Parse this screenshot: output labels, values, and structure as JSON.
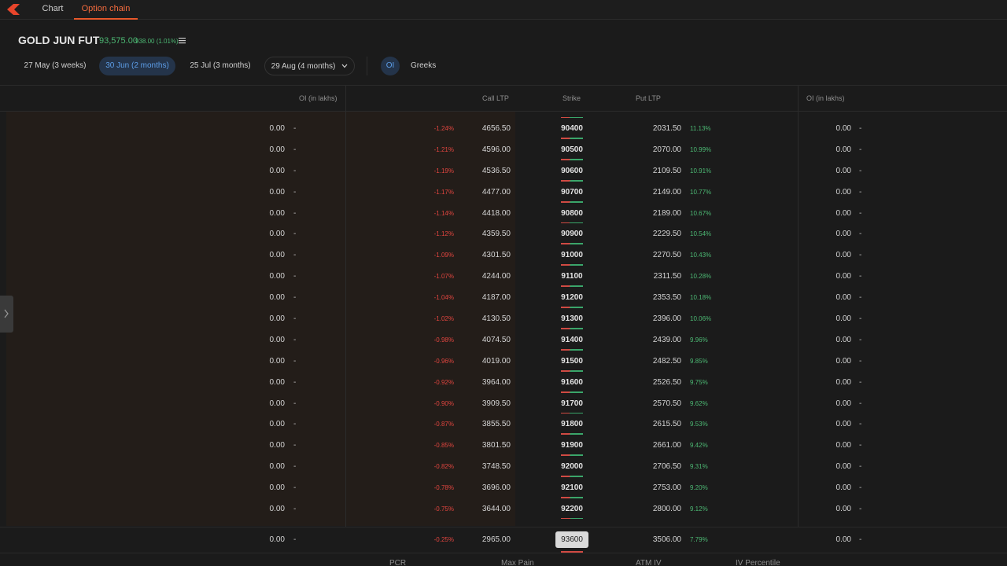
{
  "tabs": [
    {
      "label": "Chart"
    },
    {
      "label": "Option chain"
    }
  ],
  "instrument": {
    "title": "GOLD JUN FUT",
    "ltp": "93,575.00",
    "change": "938.00 (1.01%)"
  },
  "expiries": [
    {
      "label": "27 May (3 weeks)"
    },
    {
      "label": "30 Jun (2 months)"
    },
    {
      "label": "25 Jul (3 months)"
    },
    {
      "label": "29 Aug (4 months)"
    }
  ],
  "view_toggle": {
    "oi": "OI",
    "greeks": "Greeks"
  },
  "columns": {
    "call_oi": "OI (in lakhs)",
    "call_ltp": "Call LTP",
    "strike": "Strike",
    "put_ltp": "Put LTP",
    "put_oi": "OI (in lakhs)"
  },
  "rows": [
    {
      "call_oi": "0.00",
      "call_oi_chg": "-",
      "call_chg": "-1.24%",
      "call_ltp": "4656.50",
      "strike": "90400",
      "put_ltp": "2031.50",
      "put_chg": "11.13%",
      "put_oi": "0.00",
      "put_oi_chg": "-"
    },
    {
      "call_oi": "0.00",
      "call_oi_chg": "-",
      "call_chg": "-1.21%",
      "call_ltp": "4596.00",
      "strike": "90500",
      "put_ltp": "2070.00",
      "put_chg": "10.99%",
      "put_oi": "0.00",
      "put_oi_chg": "-"
    },
    {
      "call_oi": "0.00",
      "call_oi_chg": "-",
      "call_chg": "-1.19%",
      "call_ltp": "4536.50",
      "strike": "90600",
      "put_ltp": "2109.50",
      "put_chg": "10.91%",
      "put_oi": "0.00",
      "put_oi_chg": "-"
    },
    {
      "call_oi": "0.00",
      "call_oi_chg": "-",
      "call_chg": "-1.17%",
      "call_ltp": "4477.00",
      "strike": "90700",
      "put_ltp": "2149.00",
      "put_chg": "10.77%",
      "put_oi": "0.00",
      "put_oi_chg": "-"
    },
    {
      "call_oi": "0.00",
      "call_oi_chg": "-",
      "call_chg": "-1.14%",
      "call_ltp": "4418.00",
      "strike": "90800",
      "put_ltp": "2189.00",
      "put_chg": "10.67%",
      "put_oi": "0.00",
      "put_oi_chg": "-"
    },
    {
      "call_oi": "0.00",
      "call_oi_chg": "-",
      "call_chg": "-1.12%",
      "call_ltp": "4359.50",
      "strike": "90900",
      "put_ltp": "2229.50",
      "put_chg": "10.54%",
      "put_oi": "0.00",
      "put_oi_chg": "-"
    },
    {
      "call_oi": "0.00",
      "call_oi_chg": "-",
      "call_chg": "-1.09%",
      "call_ltp": "4301.50",
      "strike": "91000",
      "put_ltp": "2270.50",
      "put_chg": "10.43%",
      "put_oi": "0.00",
      "put_oi_chg": "-"
    },
    {
      "call_oi": "0.00",
      "call_oi_chg": "-",
      "call_chg": "-1.07%",
      "call_ltp": "4244.00",
      "strike": "91100",
      "put_ltp": "2311.50",
      "put_chg": "10.28%",
      "put_oi": "0.00",
      "put_oi_chg": "-"
    },
    {
      "call_oi": "0.00",
      "call_oi_chg": "-",
      "call_chg": "-1.04%",
      "call_ltp": "4187.00",
      "strike": "91200",
      "put_ltp": "2353.50",
      "put_chg": "10.18%",
      "put_oi": "0.00",
      "put_oi_chg": "-"
    },
    {
      "call_oi": "0.00",
      "call_oi_chg": "-",
      "call_chg": "-1.02%",
      "call_ltp": "4130.50",
      "strike": "91300",
      "put_ltp": "2396.00",
      "put_chg": "10.06%",
      "put_oi": "0.00",
      "put_oi_chg": "-"
    },
    {
      "call_oi": "0.00",
      "call_oi_chg": "-",
      "call_chg": "-0.98%",
      "call_ltp": "4074.50",
      "strike": "91400",
      "put_ltp": "2439.00",
      "put_chg": "9.96%",
      "put_oi": "0.00",
      "put_oi_chg": "-"
    },
    {
      "call_oi": "0.00",
      "call_oi_chg": "-",
      "call_chg": "-0.96%",
      "call_ltp": "4019.00",
      "strike": "91500",
      "put_ltp": "2482.50",
      "put_chg": "9.85%",
      "put_oi": "0.00",
      "put_oi_chg": "-"
    },
    {
      "call_oi": "0.00",
      "call_oi_chg": "-",
      "call_chg": "-0.92%",
      "call_ltp": "3964.00",
      "strike": "91600",
      "put_ltp": "2526.50",
      "put_chg": "9.75%",
      "put_oi": "0.00",
      "put_oi_chg": "-"
    },
    {
      "call_oi": "0.00",
      "call_oi_chg": "-",
      "call_chg": "-0.90%",
      "call_ltp": "3909.50",
      "strike": "91700",
      "put_ltp": "2570.50",
      "put_chg": "9.62%",
      "put_oi": "0.00",
      "put_oi_chg": "-"
    },
    {
      "call_oi": "0.00",
      "call_oi_chg": "-",
      "call_chg": "-0.87%",
      "call_ltp": "3855.50",
      "strike": "91800",
      "put_ltp": "2615.50",
      "put_chg": "9.53%",
      "put_oi": "0.00",
      "put_oi_chg": "-"
    },
    {
      "call_oi": "0.00",
      "call_oi_chg": "-",
      "call_chg": "-0.85%",
      "call_ltp": "3801.50",
      "strike": "91900",
      "put_ltp": "2661.00",
      "put_chg": "9.42%",
      "put_oi": "0.00",
      "put_oi_chg": "-"
    },
    {
      "call_oi": "0.00",
      "call_oi_chg": "-",
      "call_chg": "-0.82%",
      "call_ltp": "3748.50",
      "strike": "92000",
      "put_ltp": "2706.50",
      "put_chg": "9.31%",
      "put_oi": "0.00",
      "put_oi_chg": "-"
    },
    {
      "call_oi": "0.00",
      "call_oi_chg": "-",
      "call_chg": "-0.78%",
      "call_ltp": "3696.00",
      "strike": "92100",
      "put_ltp": "2753.00",
      "put_chg": "9.20%",
      "put_oi": "0.00",
      "put_oi_chg": "-"
    },
    {
      "call_oi": "0.00",
      "call_oi_chg": "-",
      "call_chg": "-0.75%",
      "call_ltp": "3644.00",
      "strike": "92200",
      "put_ltp": "2800.00",
      "put_chg": "9.12%",
      "put_oi": "0.00",
      "put_oi_chg": "-"
    }
  ],
  "atm_row": {
    "call_oi": "0.00",
    "call_oi_chg": "-",
    "call_chg": "-0.25%",
    "call_ltp": "2965.00",
    "strike": "93600",
    "put_ltp": "3506.00",
    "put_chg": "7.79%",
    "put_oi": "0.00",
    "put_oi_chg": "-"
  },
  "footer": {
    "pcr": "PCR",
    "max_pain": "Max Pain",
    "atm_iv": "ATM IV",
    "iv_percentile": "IV Percentile"
  },
  "colors": {
    "accent": "#e8582b",
    "active_blue": "#5d9ee8",
    "positive": "#4cb873",
    "negative": "#e0453f"
  },
  "icons": {
    "logo": "brand-logo-icon",
    "menu": "list-menu-icon",
    "chevron": "chevron-down-icon",
    "handle": "chevron-right-icon"
  }
}
